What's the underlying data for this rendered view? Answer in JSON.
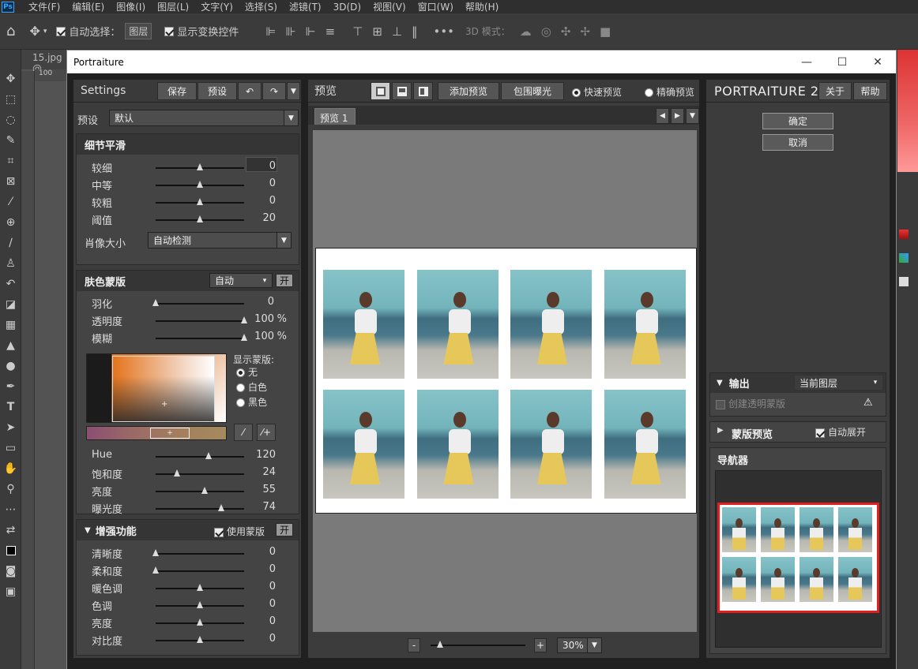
{
  "ps": {
    "logo": "Ps",
    "menu": [
      "文件(F)",
      "编辑(E)",
      "图像(I)",
      "图层(L)",
      "文字(Y)",
      "选择(S)",
      "滤镜(T)",
      "3D(D)",
      "视图(V)",
      "窗口(W)",
      "帮助(H)"
    ],
    "options": {
      "auto_select_label": "自动选择：",
      "auto_select_value": "图层",
      "show_transform_label": "显示变换控件",
      "mode3d_label": "3D 模式："
    },
    "doc_tab": "15.jpg @",
    "ruler_mark": "100"
  },
  "dialog": {
    "title": "Portraiture",
    "settings": {
      "title": "Settings",
      "save": "保存",
      "preset_btn": "预设",
      "preset_label": "预设",
      "preset_value": "默认"
    },
    "detail_smoothing": {
      "title": "细节平滑",
      "rows": [
        {
          "label": "较细",
          "value": "0",
          "pos": 0.5
        },
        {
          "label": "中等",
          "value": "0",
          "pos": 0.5
        },
        {
          "label": "较粗",
          "value": "0",
          "pos": 0.5
        },
        {
          "label": "阈值",
          "value": "20",
          "pos": 0.5
        }
      ],
      "portrait_size_label": "肖像大小",
      "portrait_size_value": "自动检测"
    },
    "skin_mask": {
      "title": "肤色蒙版",
      "mode": "自动",
      "toggle": "开",
      "rows": [
        {
          "label": "羽化",
          "value": "0",
          "unit": "",
          "pos": 0.0
        },
        {
          "label": "透明度",
          "value": "100",
          "unit": "%",
          "pos": 1.0
        },
        {
          "label": "模糊",
          "value": "100",
          "unit": "%",
          "pos": 1.0
        }
      ],
      "show_mask_label": "显示蒙版:",
      "show_mask_options": [
        {
          "label": "无",
          "selected": true
        },
        {
          "label": "白色",
          "selected": false
        },
        {
          "label": "黑色",
          "selected": false
        }
      ],
      "color_rows": [
        {
          "label": "Hue",
          "value": "120",
          "pos": 0.6
        },
        {
          "label": "饱和度",
          "value": "24",
          "pos": 0.24
        },
        {
          "label": "亮度",
          "value": "55",
          "pos": 0.55
        },
        {
          "label": "曝光度",
          "value": "74",
          "pos": 0.74
        }
      ]
    },
    "enhance": {
      "title": "增强功能",
      "use_mask_label": "使用蒙版",
      "toggle": "开",
      "rows": [
        {
          "label": "清晰度",
          "value": "0",
          "pos": 0.0
        },
        {
          "label": "柔和度",
          "value": "0",
          "pos": 0.0
        },
        {
          "label": "暖色调",
          "value": "0",
          "pos": 0.5
        },
        {
          "label": "色调",
          "value": "0",
          "pos": 0.5
        },
        {
          "label": "亮度",
          "value": "0",
          "pos": 0.5
        },
        {
          "label": "对比度",
          "value": "0",
          "pos": 0.5
        }
      ]
    },
    "preview": {
      "title": "预览",
      "add_preview": "添加预览",
      "clip_exposure": "包围曝光",
      "fast_preview": "快速预览",
      "accurate_preview": "精确预览",
      "tab": "预览 1",
      "zoom_minus": "-",
      "zoom_plus": "+",
      "zoom_value": "30%",
      "zoom_level": 0.1
    },
    "right": {
      "brand": "PORTRAITURE 2",
      "about": "关于",
      "help": "帮助",
      "ok": "确定",
      "cancel": "取消",
      "output_label": "输出",
      "output_value": "当前图层",
      "create_mask": "创建透明蒙版",
      "mask_preview": "蒙版预览",
      "auto_expand": "自动展开",
      "navigator": "导航器"
    }
  }
}
